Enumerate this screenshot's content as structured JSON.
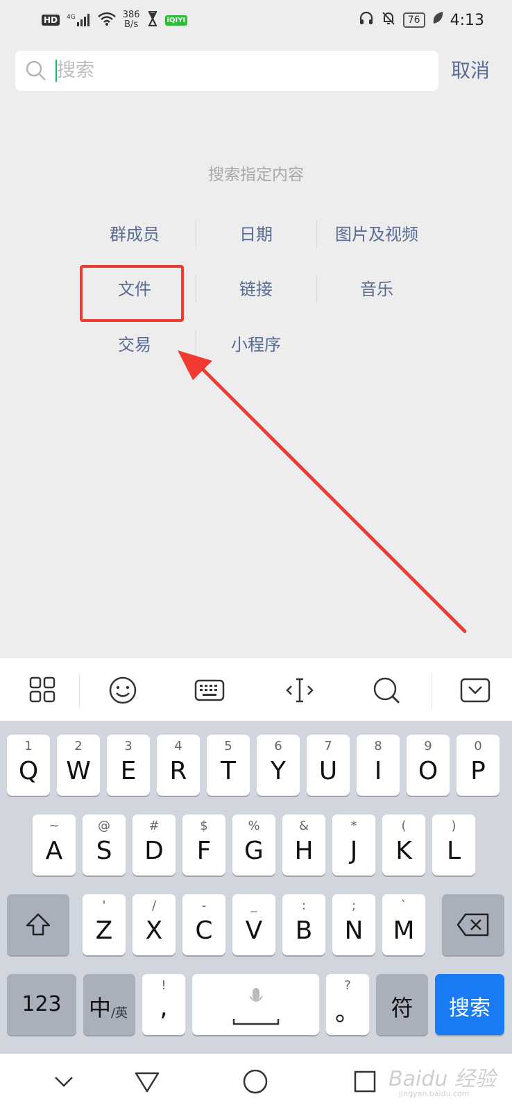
{
  "status_bar": {
    "hd_label": "HD",
    "network": "4G",
    "speed_value": "386",
    "speed_unit": "B/s",
    "app_badge": "iQIYI",
    "battery": "76",
    "time": "4:13"
  },
  "search": {
    "placeholder": "搜索",
    "cancel_label": "取消"
  },
  "hint_text": "搜索指定内容",
  "categories": [
    {
      "label": "群成员"
    },
    {
      "label": "日期"
    },
    {
      "label": "图片及视频"
    },
    {
      "label": "文件"
    },
    {
      "label": "链接"
    },
    {
      "label": "音乐"
    },
    {
      "label": "交易"
    },
    {
      "label": "小程序"
    }
  ],
  "annotation_color": "#f13b30",
  "keyboard": {
    "row1": [
      {
        "hint": "1",
        "char": "Q"
      },
      {
        "hint": "2",
        "char": "W"
      },
      {
        "hint": "3",
        "char": "E"
      },
      {
        "hint": "4",
        "char": "R"
      },
      {
        "hint": "5",
        "char": "T"
      },
      {
        "hint": "6",
        "char": "Y"
      },
      {
        "hint": "7",
        "char": "U"
      },
      {
        "hint": "8",
        "char": "I"
      },
      {
        "hint": "9",
        "char": "O"
      },
      {
        "hint": "0",
        "char": "P"
      }
    ],
    "row2": [
      {
        "hint": "~",
        "char": "A"
      },
      {
        "hint": "@",
        "char": "S"
      },
      {
        "hint": "#",
        "char": "D"
      },
      {
        "hint": "$",
        "char": "F"
      },
      {
        "hint": "%",
        "char": "G"
      },
      {
        "hint": "&",
        "char": "H"
      },
      {
        "hint": "*",
        "char": "J"
      },
      {
        "hint": "(",
        "char": "K"
      },
      {
        "hint": ")",
        "char": "L"
      }
    ],
    "row3": [
      {
        "hint": "'",
        "char": "Z"
      },
      {
        "hint": "/",
        "char": "X"
      },
      {
        "hint": "-",
        "char": "C"
      },
      {
        "hint": "_",
        "char": "V"
      },
      {
        "hint": ":",
        "char": "B"
      },
      {
        "hint": ";",
        "char": "N"
      },
      {
        "hint": "`",
        "char": "M"
      }
    ],
    "num_label": "123",
    "lang_main": "中",
    "lang_sub": "/英",
    "comma_hint": "!",
    "comma_char": ",",
    "period_hint": "?",
    "period_char": "。",
    "symbol_label": "符",
    "search_label": "搜索"
  },
  "watermark": {
    "brand": "Baidu 经验",
    "url": "jingyan.baidu.com"
  }
}
